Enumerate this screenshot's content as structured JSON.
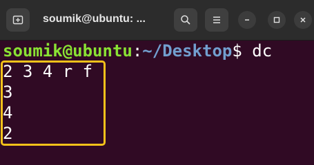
{
  "titlebar": {
    "title": "soumik@ubuntu: ...",
    "new_tab_icon": "new-tab-icon",
    "search_icon": "search-icon",
    "menu_icon": "hamburger-menu-icon",
    "minimize_icon": "minimize-icon",
    "maximize_icon": "maximize-icon",
    "close_icon": "close-icon"
  },
  "terminal": {
    "prompt": {
      "user_host": "soumik@ubuntu",
      "separator": ":",
      "path": "~/Desktop",
      "symbol": "$ ",
      "command": "dc"
    },
    "output_lines": [
      "2 3 4 r f",
      "3",
      "4",
      "2"
    ]
  },
  "colors": {
    "terminal_bg": "#300a24",
    "titlebar_bg": "#2c2c2c",
    "prompt_user": "#8ae234",
    "prompt_path": "#729fcf",
    "highlight_border": "#f6c21a"
  }
}
